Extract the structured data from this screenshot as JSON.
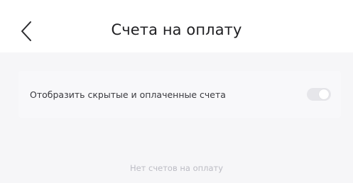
{
  "header": {
    "title": "Счета на оплату",
    "back_icon": "chevron-left-icon"
  },
  "settings": {
    "show_hidden_paid_label": "Отобразить скрытые и оплаченные счета",
    "show_hidden_paid_enabled": false
  },
  "empty_state": {
    "message": "Нет счетов на оплату"
  },
  "colors": {
    "background": "#ffffff",
    "content_background": "#f6f6f8",
    "title_text": "#1f1f22",
    "muted_text": "#bcbcc4",
    "switch_track": "#e6e6ea"
  }
}
